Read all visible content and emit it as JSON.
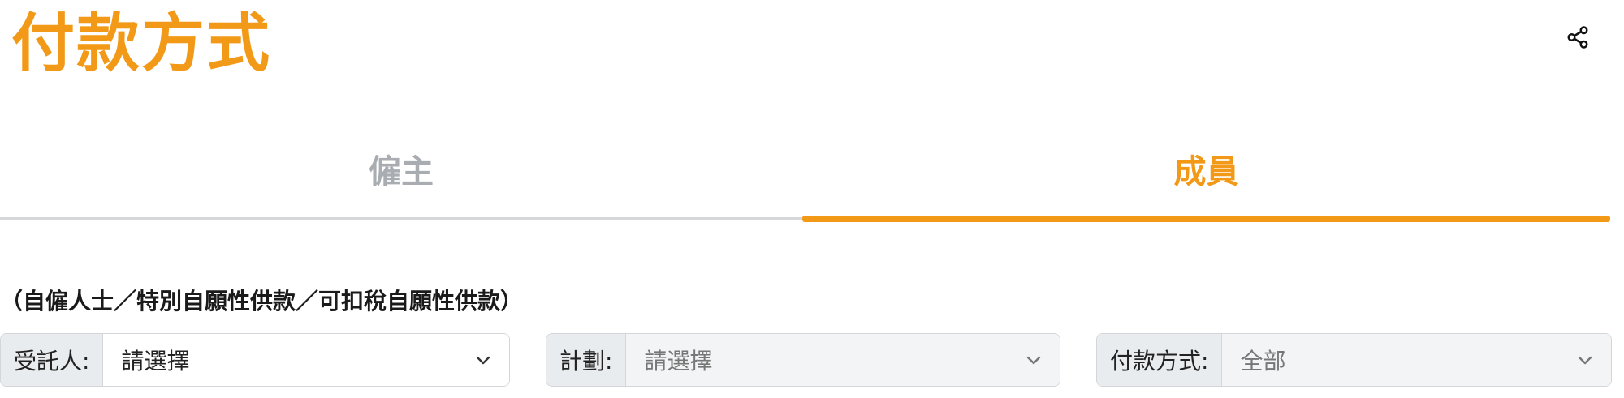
{
  "header": {
    "title": "付款方式",
    "share_icon": "share-icon"
  },
  "tabs": [
    {
      "label": "僱主",
      "active": false
    },
    {
      "label": "成員",
      "active": true
    }
  ],
  "section_note": "（自僱人士／特別自願性供款／可扣稅自願性供款）",
  "filters": {
    "trustee": {
      "label": "受託人:",
      "value": "請選擇",
      "enabled": true
    },
    "plan": {
      "label": "計劃:",
      "value": "請選擇",
      "enabled": false
    },
    "payment_method": {
      "label": "付款方式:",
      "value": "全部",
      "enabled": false
    }
  },
  "colors": {
    "accent": "#f29a18",
    "tab_inactive": "#a9adb1",
    "divider": "#d5d8da"
  }
}
